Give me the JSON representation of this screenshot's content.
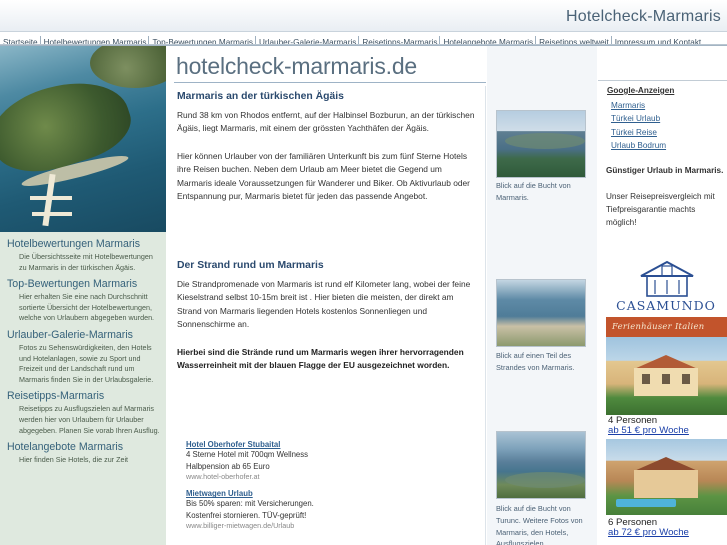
{
  "header": {
    "brand": "Hotelcheck-Marmaris"
  },
  "topnav": {
    "items": [
      "Startseite",
      "Hotelbewertungen Marmaris",
      "Top-Bewertungen Marmaris",
      "Urlauber-Galerie-Marmaris",
      "Reisetipps-Marmaris",
      "Hotelangebote Marmaris",
      "Reisetipps weltweit",
      "Impressum und Kontakt"
    ]
  },
  "leftnav": {
    "sections": [
      {
        "title": "Hotelbewertungen Marmaris",
        "desc": "Die Übersichtsseite mit Hotelbewertungen zu Marmaris in der türkischen Ägäis."
      },
      {
        "title": "Top-Bewertungen Marmaris",
        "desc": "Hier erhalten Sie eine nach Durchschnitt sortierte Übersicht der Hotelbewertungen, welche von Urlaubern abgegeben wurden."
      },
      {
        "title": "Urlauber-Galerie-Marmaris",
        "desc": "Fotos zu Sehenswürdigkeiten, den Hotels und Hotelanlagen, sowie zu Sport und Freizeit und der Landschaft rund um Marmaris finden Sie in der Urlaubsgalerie."
      },
      {
        "title": "Reisetipps-Marmaris",
        "desc": "Reisetipps zu Ausflugszielen auf Marmaris werden hier von Urlaubern für Urlauber abgegeben. Planen Sie vorab Ihren Ausflug."
      },
      {
        "title": "Hotelangebote Marmaris",
        "desc": "Hier finden Sie Hotels, die zur Zeit"
      }
    ]
  },
  "main": {
    "site_logo": "hotelcheck-marmaris.de",
    "heading1": "Marmaris an der türkischen Ägäis",
    "para1": "Rund 38 km von Rhodos entfernt, auf der Halbinsel Bozburun, an der türkischen Ägäis, liegt Marmaris, mit einem der grössten Yachthäfen der Ägäis.",
    "para2": "Hier können Urlauber von der familiären Unterkunft bis zum fünf Sterne Hotels ihre Reisen buchen. Neben dem Urlaub am Meer bietet die Gegend um Marmaris ideale Voraussetzungen für Wanderer und Biker. Ob Aktivurlaub oder Entspannung pur, Marmaris bietet für jeden das passende Angebot.",
    "heading2": "Der Strand rund um Marmaris",
    "para3": "Die Strandpromenade von Marmaris ist rund elf Kilometer lang, wobei der feine Kieselstrand selbst 10-15m breit ist . Hier bieten die meisten, der direkt am Strand von Marmaris liegenden Hotels kostenlos Sonnenliegen und Sonnenschirme an.",
    "para4_bold": "Hierbei sind die Strände rund um Marmaris wegen ihrer hervorragenden Wasserreinheit mit der blauen Flagge der EU ausgezeichnet worden."
  },
  "ads": [
    {
      "title": "Hotel Oberhofer Stubaital",
      "line1": "4 Sterne Hotel mit 700qm Wellness",
      "line2": "Halbpension ab 65 Euro",
      "url": "www.hotel-oberhofer.at"
    },
    {
      "title": "Mietwagen Urlaub",
      "line1": "Bis 50% sparen: mit Versicherungen.",
      "line2": "Kostenfrei stornieren. TÜV-geprüft!",
      "url": "www.billiger-mietwagen.de/Urlaub"
    }
  ],
  "gallery": {
    "captions": [
      "Blick auf die Bucht von Marmaris.",
      "Blick auf einen Teil des Strandes von Marmaris.",
      "Blick auf die Bucht von Turunc. Weitere Fotos von Marmaris, den Hotels, Ausflugszielen"
    ]
  },
  "rightcol": {
    "google_heading": "Google-Anzeigen",
    "google_links": [
      "Marmaris",
      "Türkei Urlaub",
      "Türkei Reise",
      "Urlaub Bodrum"
    ],
    "promo_title": "Günstiger Urlaub in Marmaris.",
    "promo_text": "Unser Reisepreisvergleich mit Tiefpreisgarantie machts möglich!",
    "casamundo": "CASAMUNDO",
    "ferienhaeuser": "Ferienhäuser Italien",
    "offers": [
      {
        "persons": "4 Personen",
        "price": "ab 51 € pro Woche"
      },
      {
        "persons": "6 Personen",
        "price": "ab 72 € pro Woche"
      }
    ]
  }
}
